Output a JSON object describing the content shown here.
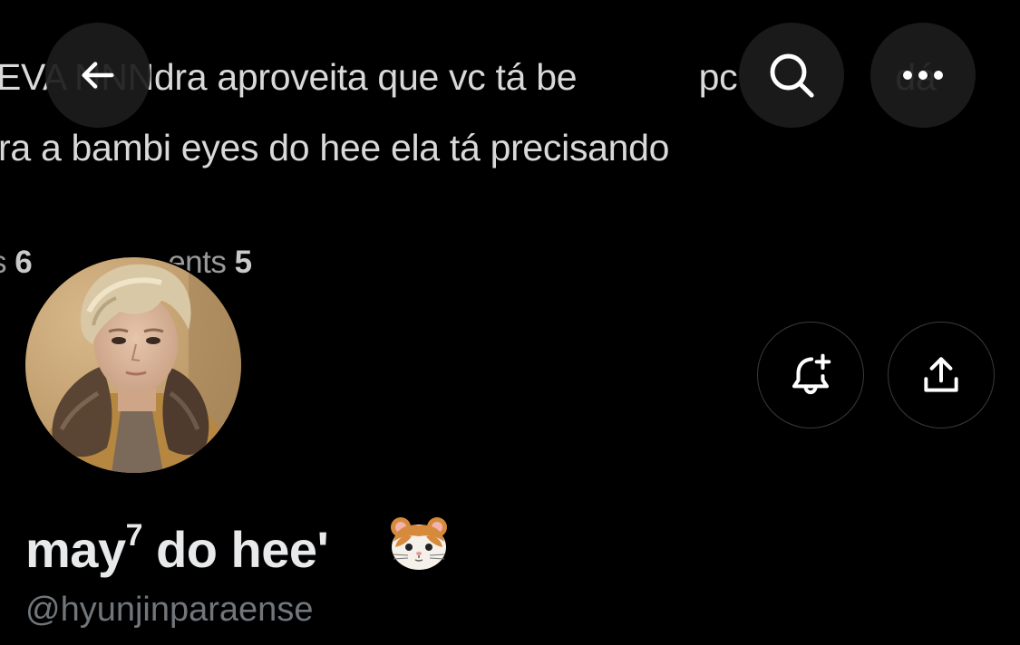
{
  "banner": {
    "line1": "EVA NNNdra aproveita que vc tá be                 pc                      dá",
    "line2": "ra a bambi eyes do hee ela tá precisando",
    "stat1_label": "s",
    "stat1_value": "6",
    "stat2_label": "ents",
    "stat2_value": "5"
  },
  "nav": {
    "back_icon": "arrow-left-icon",
    "search_icon": "search-icon",
    "more_icon": "more-horizontal-icon"
  },
  "actions": {
    "notify_icon": "bell-plus-icon",
    "share_icon": "share-upload-icon"
  },
  "profile": {
    "name_main": "may",
    "name_sup": "7",
    "name_rest": " do hee'",
    "name_emoji": "hamster-face-emoji",
    "handle": "@hyunjinparaense"
  },
  "colors": {
    "background": "#000000",
    "primary_text": "#e7e9ea",
    "secondary_text": "#71767b",
    "nav_button_bg": "#1c1c1c",
    "action_border": "#3a3a3a"
  }
}
